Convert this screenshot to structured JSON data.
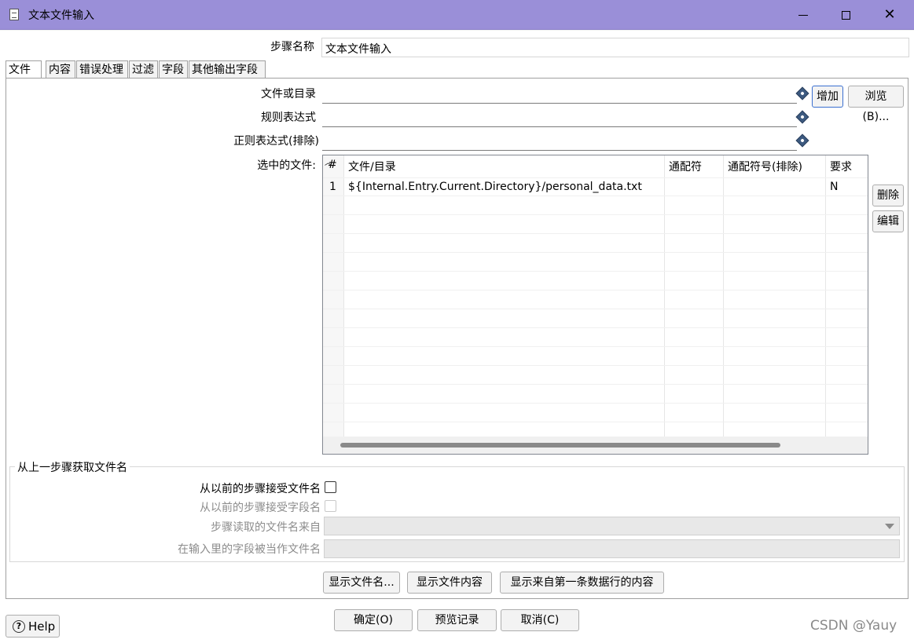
{
  "window": {
    "title": "文本文件输入"
  },
  "step_name": {
    "label": "步骤名称",
    "value": "文本文件输入"
  },
  "tabs": [
    {
      "label": "文件",
      "active": true
    },
    {
      "label": "内容",
      "active": false
    },
    {
      "label": "错误处理",
      "active": false
    },
    {
      "label": "过滤",
      "active": false
    },
    {
      "label": "字段",
      "active": false
    },
    {
      "label": "其他输出字段",
      "active": false
    }
  ],
  "file_tab": {
    "file_or_dir_label": "文件或目录",
    "file_or_dir_value": "",
    "regex_label": "规则表达式",
    "regex_value": "",
    "regex_exclude_label": "正则表达式(排除)",
    "regex_exclude_value": "",
    "add_button": "增加",
    "browse_button": "浏览(B)...",
    "selected_files_label": "选中的文件:",
    "delete_button": "删除",
    "edit_button": "编辑"
  },
  "files_table": {
    "columns": [
      "#",
      "文件/目录",
      "通配符",
      "通配符号(排除)",
      "要求"
    ],
    "rows": [
      {
        "num": "1",
        "path": "${Internal.Entry.Current.Directory}/personal_data.txt",
        "wildcard": "",
        "wildcard_exclude": "",
        "required": "N"
      }
    ]
  },
  "from_previous": {
    "legend": "从上一步骤获取文件名",
    "accept_filenames_label": "从以前的步骤接受文件名",
    "accept_filenames_checked": false,
    "accept_fieldnames_label": "从以前的步骤接受字段名",
    "accept_fieldnames_checked": false,
    "step_source_label": "步骤读取的文件名来自",
    "step_source_value": "",
    "field_as_filename_label": "在输入里的字段被当作文件名",
    "field_as_filename_value": ""
  },
  "panel_buttons": {
    "show_filenames": "显示文件名...",
    "show_file_content": "显示文件内容",
    "show_first_row": "显示来自第一条数据行的内容"
  },
  "dialog_buttons": {
    "ok": "确定(O)",
    "preview": "预览记录",
    "cancel": "取消(C)",
    "help": "Help"
  },
  "watermark": "CSDN @Yauy"
}
